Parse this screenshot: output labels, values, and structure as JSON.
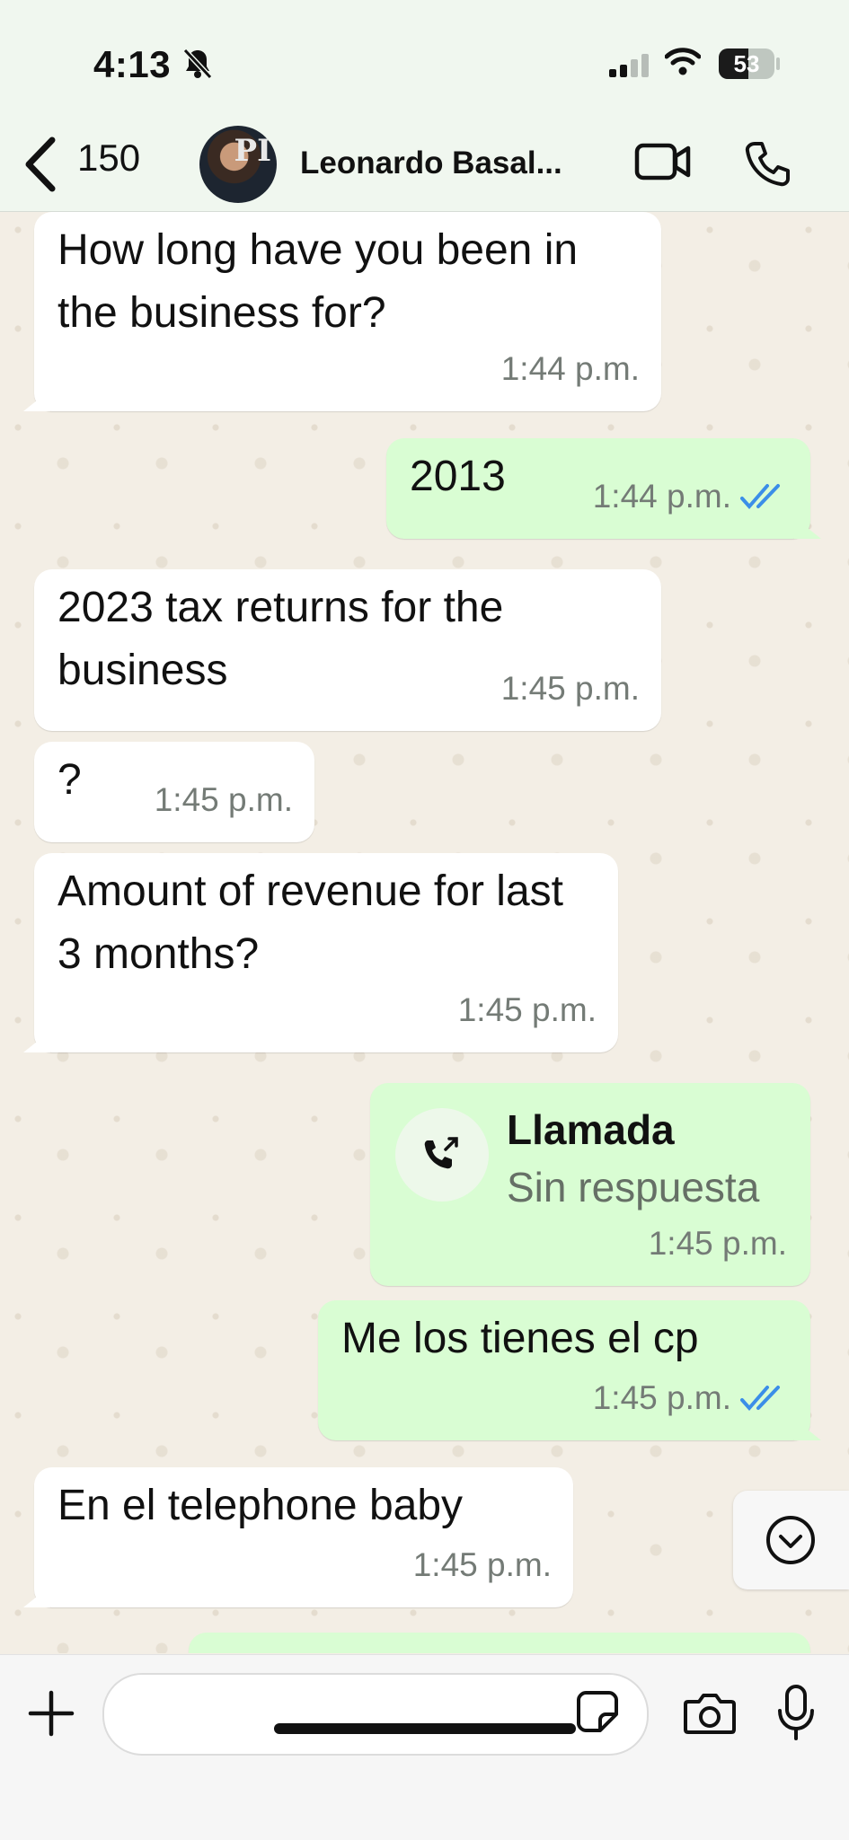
{
  "status_bar": {
    "time": "4:13",
    "battery": "53",
    "battery_level_percent": 53
  },
  "header": {
    "back_count": "150",
    "contact_name": "Leonardo Basal...",
    "avatar_monogram": "PI"
  },
  "messages": [
    {
      "dir": "in",
      "text": "How long have you been in the business for?",
      "time": "1:44 p.m."
    },
    {
      "dir": "out",
      "text": "2013",
      "time": "1:44 p.m.",
      "read": true
    },
    {
      "dir": "in",
      "text": "2023 tax returns for the business",
      "time": "1:45 p.m."
    },
    {
      "dir": "in",
      "text": "?",
      "time": "1:45 p.m."
    },
    {
      "dir": "in",
      "text": "Amount of revenue for last 3 months?",
      "time": "1:45 p.m."
    },
    {
      "dir": "out",
      "type": "call",
      "title": "Llamada",
      "subtitle": "Sin respuesta",
      "time": "1:45 p.m."
    },
    {
      "dir": "out",
      "text": "Me los tienes el cp",
      "time": "1:45 p.m.",
      "read": true
    },
    {
      "dir": "in",
      "text": "En el telephone baby",
      "time": "1:45 p.m."
    }
  ],
  "composer": {
    "placeholder": ""
  },
  "colors": {
    "incoming": "#ffffff",
    "outgoing": "#d9fdd3",
    "read_tick": "#3b8ee8",
    "chat_bg": "#f3eee5"
  },
  "icons": [
    "bell-slash-icon",
    "signal-icon",
    "wifi-icon",
    "back-chevron-icon",
    "video-call-icon",
    "phone-icon",
    "missed-call-icon",
    "chevron-down-icon",
    "plus-icon",
    "sticker-icon",
    "camera-icon",
    "mic-icon"
  ]
}
